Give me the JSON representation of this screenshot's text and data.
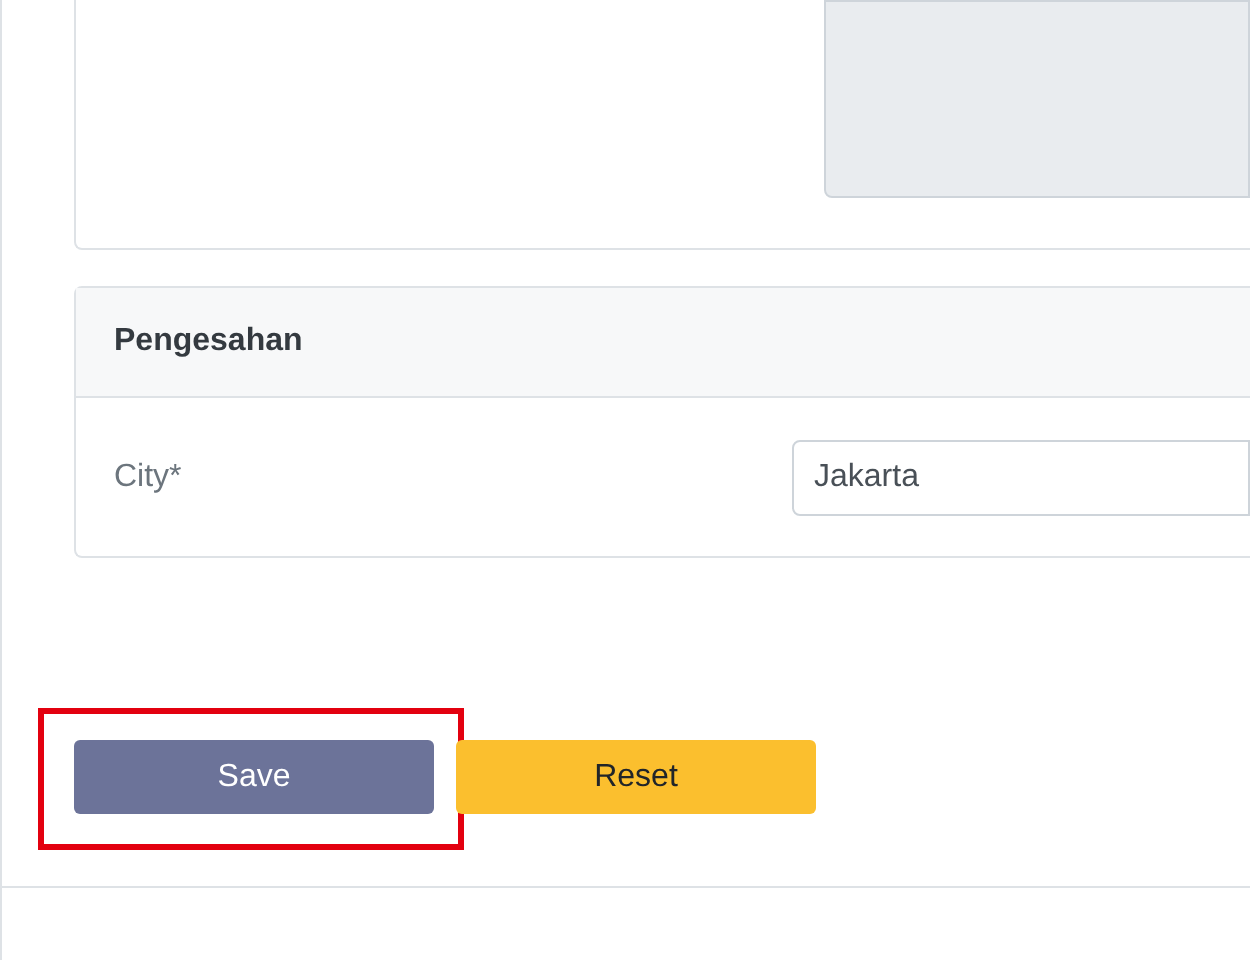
{
  "top_card": {
    "textarea": {
      "disabled": true
    }
  },
  "section": {
    "title": "Pengesahan",
    "fields": [
      {
        "label": "City*",
        "value": "Jakarta"
      }
    ]
  },
  "buttons": [
    {
      "label": "Save",
      "kind": "primary",
      "highlighted": true
    },
    {
      "label": "Reset",
      "kind": "warning",
      "highlighted": false
    }
  ]
}
